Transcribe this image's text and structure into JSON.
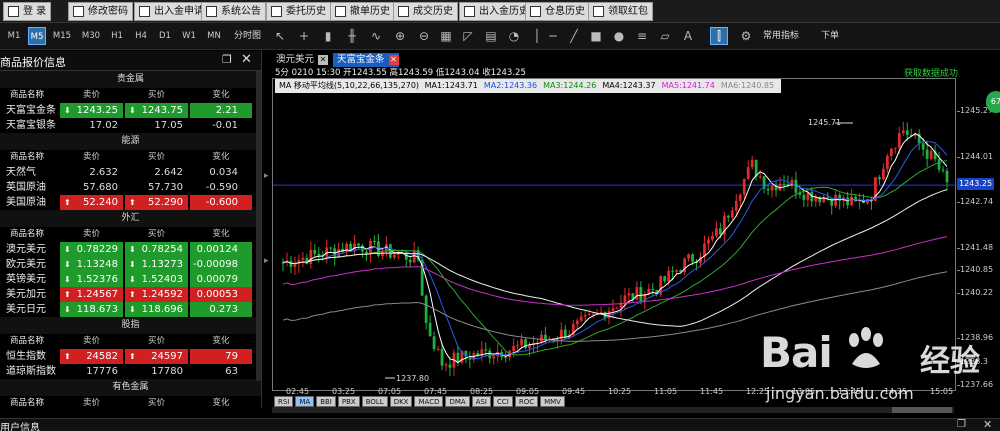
{
  "toolbar": {
    "buttons": [
      {
        "label": "登  录"
      },
      {
        "label": "修改密码"
      },
      {
        "label": "出入金申请"
      },
      {
        "label": "系统公告"
      },
      {
        "label": "委托历史"
      },
      {
        "label": "撤单历史"
      },
      {
        "label": "成交历史"
      },
      {
        "label": "出入金历史"
      },
      {
        "label": "仓息历史"
      },
      {
        "label": "领取红包"
      }
    ]
  },
  "periods": {
    "items": [
      "M1",
      "M5",
      "M15",
      "M30",
      "H1",
      "H4",
      "D1",
      "W1",
      "MN"
    ],
    "active": "M5",
    "timeshare_label": "分时图",
    "indicator_label": "常用指标",
    "order_label": "下单"
  },
  "left_panel": {
    "title": "商品报价信息",
    "sections": [
      {
        "category": "贵金属",
        "headers": [
          "商品名称",
          "卖价",
          "买价",
          "变化"
        ],
        "rows": [
          {
            "name": "天富宝金条",
            "sell": "1243.25",
            "buy": "1243.75",
            "change": "2.21",
            "color": "green"
          },
          {
            "name": "天富宝银条",
            "sell": "17.02",
            "buy": "17.05",
            "change": "-0.01",
            "color": "none"
          }
        ]
      },
      {
        "category": "能源",
        "headers": [
          "商品名称",
          "卖价",
          "买价",
          "变化"
        ],
        "rows": [
          {
            "name": "天然气",
            "sell": "2.632",
            "buy": "2.642",
            "change": "0.034",
            "color": "none"
          },
          {
            "name": "英国原油",
            "sell": "57.680",
            "buy": "57.730",
            "change": "-0.590",
            "color": "none"
          },
          {
            "name": "美国原油",
            "sell": "52.240",
            "buy": "52.290",
            "change": "-0.600",
            "color": "red"
          }
        ]
      },
      {
        "category": "外汇",
        "headers": [
          "商品名称",
          "卖价",
          "买价",
          "变化"
        ],
        "rows": [
          {
            "name": "澳元美元",
            "sell": "0.78229",
            "buy": "0.78254",
            "change": "0.00124",
            "color": "green"
          },
          {
            "name": "欧元美元",
            "sell": "1.13248",
            "buy": "1.13273",
            "change": "-0.00098",
            "color": "green"
          },
          {
            "name": "英镑美元",
            "sell": "1.52376",
            "buy": "1.52403",
            "change": "0.00079",
            "color": "green"
          },
          {
            "name": "美元加元",
            "sell": "1.24567",
            "buy": "1.24592",
            "change": "0.00053",
            "color": "red"
          },
          {
            "name": "美元日元",
            "sell": "118.673",
            "buy": "118.696",
            "change": "0.273",
            "color": "green"
          }
        ]
      },
      {
        "category": "股指",
        "headers": [
          "商品名称",
          "卖价",
          "买价",
          "变化"
        ],
        "rows": [
          {
            "name": "恒生指数",
            "sell": "24582",
            "buy": "24597",
            "change": "79",
            "color": "red"
          },
          {
            "name": "道琼斯指数",
            "sell": "17776",
            "buy": "17780",
            "change": "63",
            "color": "none"
          }
        ]
      },
      {
        "category": "有色金属",
        "headers": [
          "商品名称",
          "卖价",
          "买价",
          "变化"
        ],
        "rows": []
      }
    ]
  },
  "bottom_bar": {
    "title": "用户信息"
  },
  "chart": {
    "tabs": [
      {
        "label": "澳元美元",
        "active": false
      },
      {
        "label": "天富宝金条",
        "active": true
      }
    ],
    "info_line": "5分 0210 15:30 开1243.55 高1243.59 低1243.04 收1243.25",
    "status": "获取数据成功",
    "ma_bar": {
      "prefix": "MA 移动平均线(5,10,22,66,135,270)",
      "items": [
        {
          "label": "MA1:1243.71",
          "color": "#000000"
        },
        {
          "label": "MA2:1243.36",
          "color": "#1a4fe0"
        },
        {
          "label": "MA3:1244.26",
          "color": "#0a8f0a"
        },
        {
          "label": "MA4:1243.37",
          "color": "#000000"
        },
        {
          "label": "MA5:1241.74",
          "color": "#d81bd8"
        },
        {
          "label": "MA6:1240.85",
          "color": "#888888"
        }
      ]
    },
    "current_price": "1243.25",
    "indicator_tabs": [
      "RSI",
      "MA",
      "BBI",
      "PBX",
      "BOLL",
      "DKX",
      "MACD",
      "DMA",
      "ASI",
      "CCI",
      "ROC",
      "MMV"
    ],
    "active_indicator": "MA",
    "max_label": "1245.71",
    "min_label": "1237.80",
    "badge_label": "67"
  },
  "chart_data": {
    "type": "candlestick",
    "symbol": "天富宝金条",
    "interval": "5分",
    "y_ticks": [
      1245.27,
      1244.01,
      1242.74,
      1241.48,
      1240.85,
      1240.22,
      1238.96,
      1238.3,
      1237.66
    ],
    "y_range": [
      1237.5,
      1246.2
    ],
    "x_ticks": [
      "02:45",
      "03:25",
      "07:05",
      "07:45",
      "08:25",
      "09:05",
      "09:45",
      "10:25",
      "11:05",
      "11:45",
      "12:25",
      "13:05",
      "13:45",
      "14:25",
      "15:05"
    ],
    "current_price": 1243.25,
    "high_mark": 1245.71,
    "low_mark": 1237.8
  },
  "watermark": {
    "brand": "Bai",
    "brand2": "经验",
    "url": "jingyan.baidu.com"
  },
  "colors": {
    "up": "#e22a2a",
    "down": "#20b040",
    "accent": "#1a5dbd"
  }
}
